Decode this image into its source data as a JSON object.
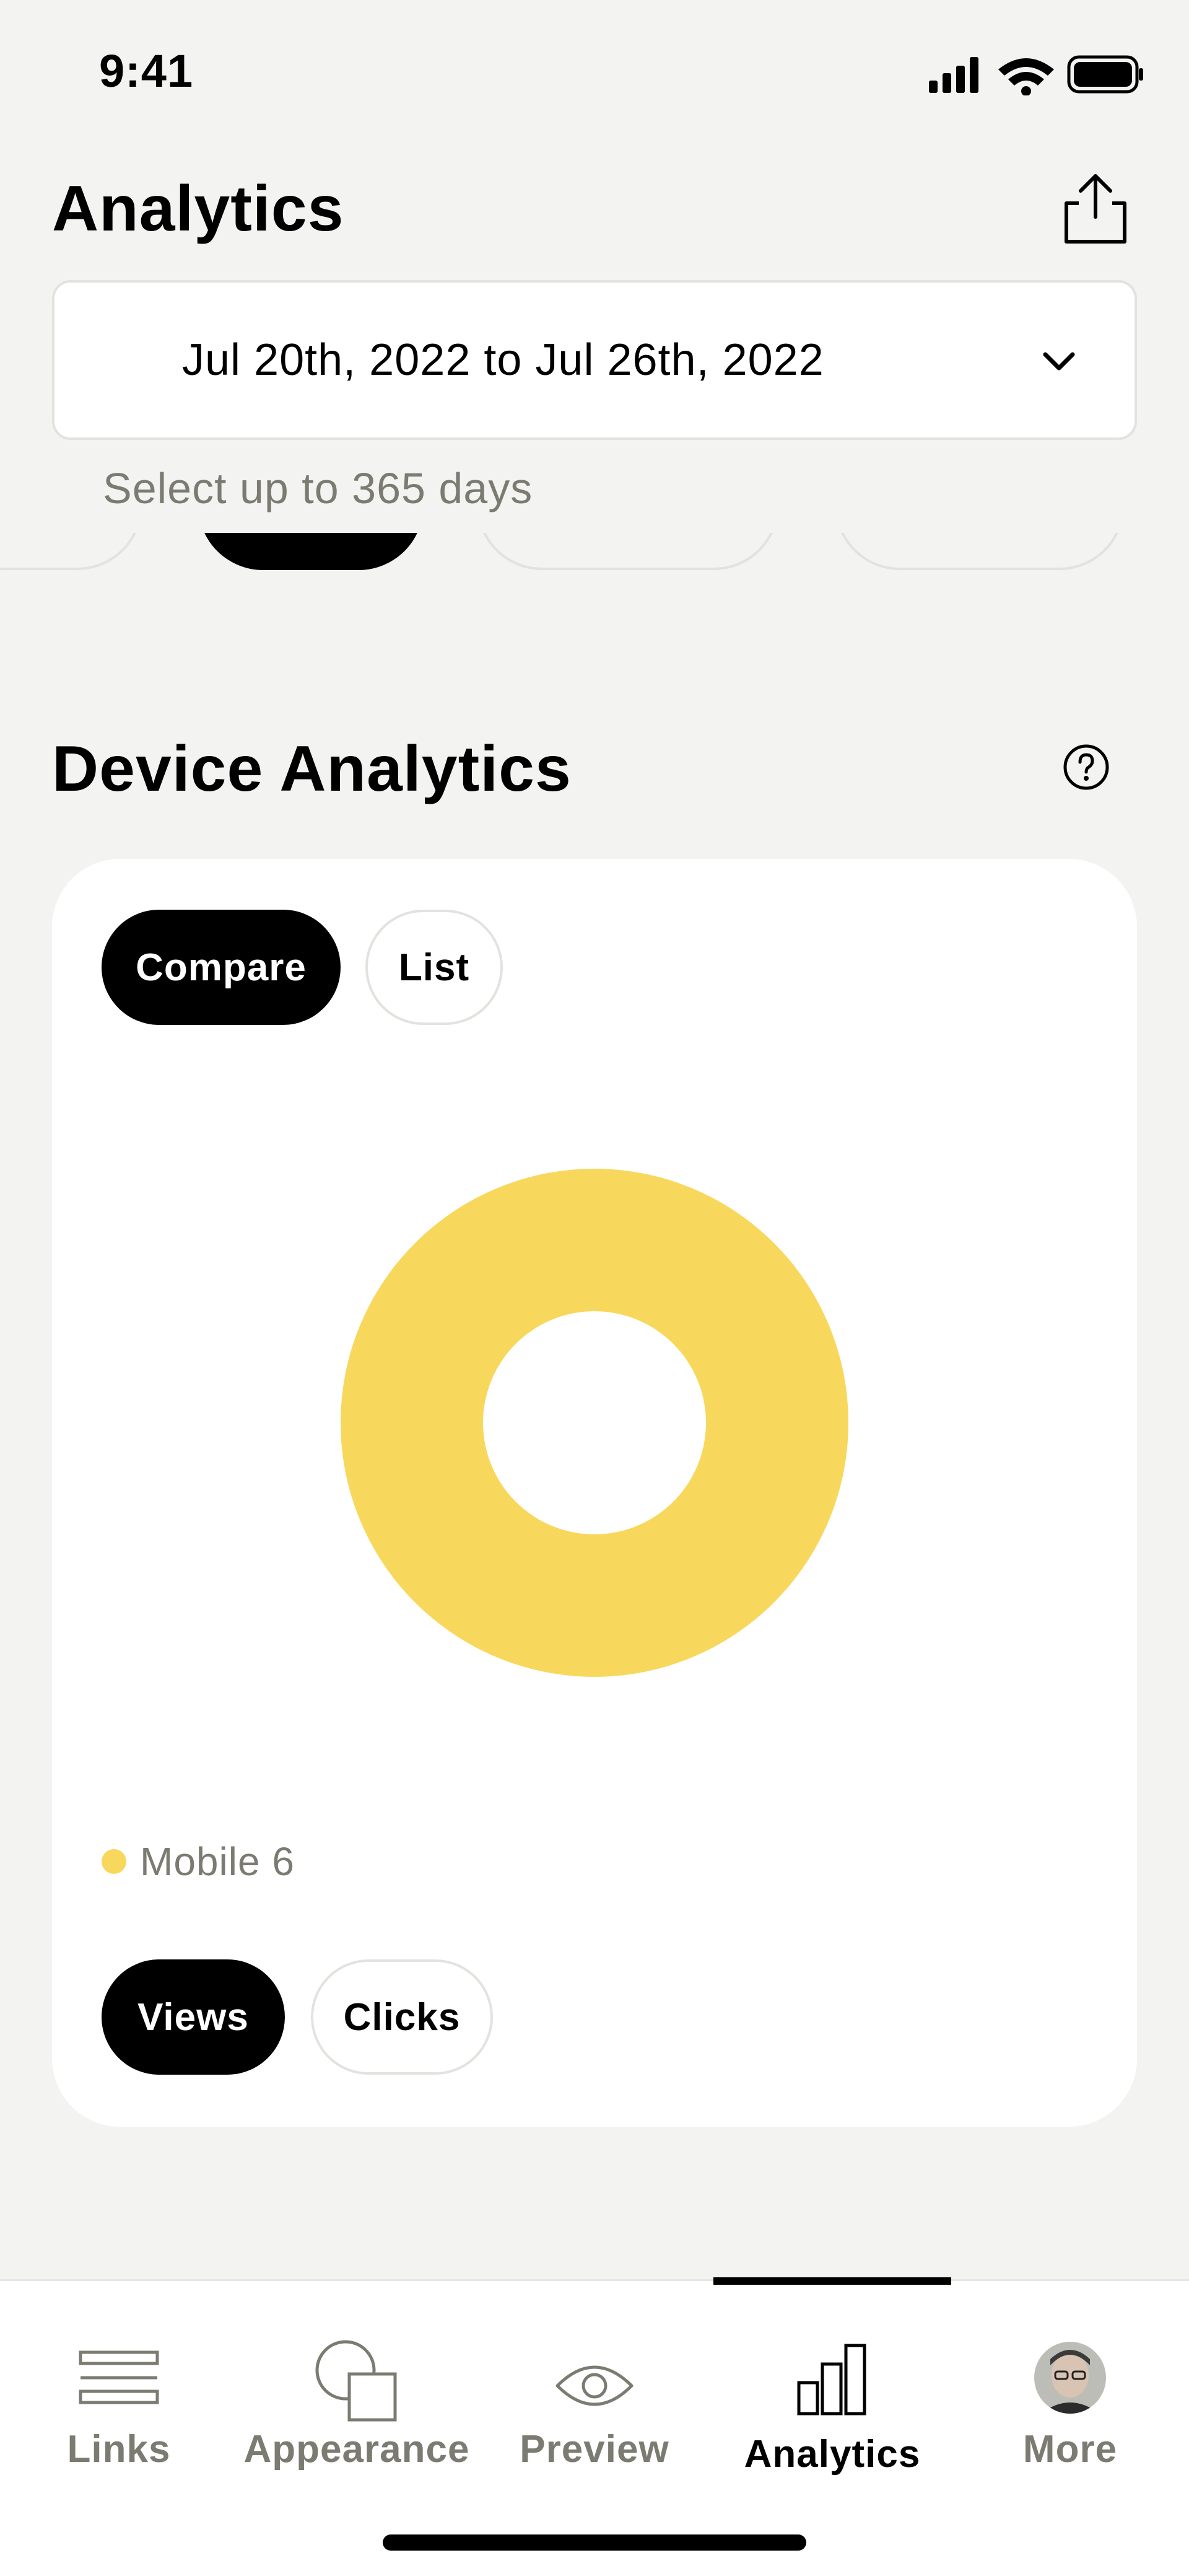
{
  "status_bar": {
    "time": "9:41"
  },
  "header": {
    "title": "Analytics"
  },
  "date_picker": {
    "range": "Jul 20th, 2022 to Jul 26th, 2022",
    "hint": "Select up to 365 days"
  },
  "device_analytics": {
    "title": "Device Analytics",
    "view_toggle": {
      "compare": "Compare",
      "list": "List",
      "selected": "Compare"
    },
    "metric_toggle": {
      "views": "Views",
      "clicks": "Clicks",
      "selected": "Views"
    },
    "legend": [
      {
        "label": "Mobile 6",
        "color": "#f8d85c"
      }
    ]
  },
  "chart_data": {
    "type": "pie",
    "donut": true,
    "categories": [
      "Mobile"
    ],
    "values": [
      6
    ],
    "colors": [
      "#f8d85c"
    ]
  },
  "bottom_nav": {
    "items": [
      {
        "label": "Links",
        "icon": "links-icon"
      },
      {
        "label": "Appearance",
        "icon": "appearance-icon"
      },
      {
        "label": "Preview",
        "icon": "eye-icon"
      },
      {
        "label": "Analytics",
        "icon": "bar-chart-icon"
      },
      {
        "label": "More",
        "icon": "avatar"
      }
    ],
    "active": "Analytics"
  },
  "colors": {
    "accent": "#f8d85c",
    "background": "#f3f3f1",
    "muted_text": "#7b7b72"
  }
}
